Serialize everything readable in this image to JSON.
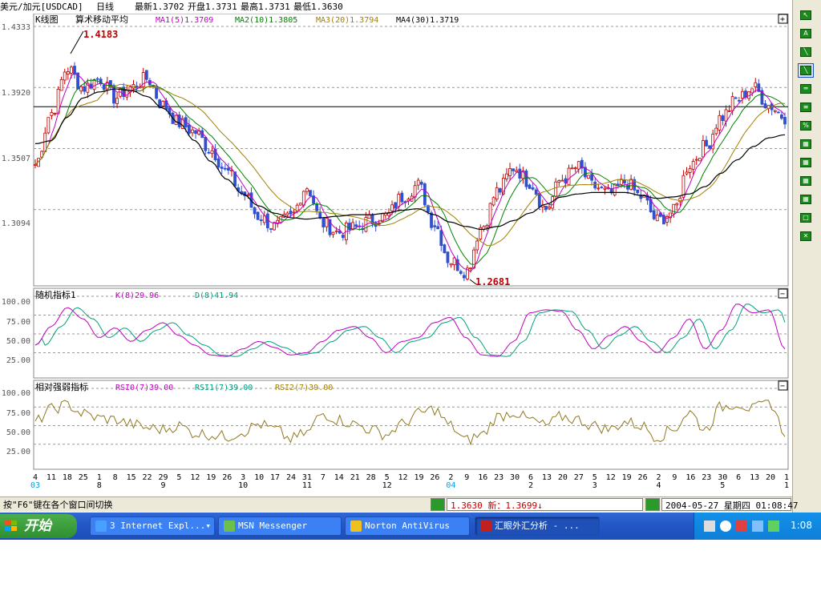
{
  "header": {
    "symbol": "美元/加元[USDCAD]",
    "period": "日线",
    "latest": "最新1.3702",
    "open": "开盘1.3731",
    "high": "最高1.3731",
    "low": "最低1.3630"
  },
  "main_chart": {
    "title": "K线图",
    "indicator_name": "算术移动平均",
    "ma_labels": [
      {
        "text": "MA1(5)1.3709",
        "color": "#c000c0"
      },
      {
        "text": "MA2(10)1.3805",
        "color": "#008000"
      },
      {
        "text": "MA3(20)1.3794",
        "color": "#a08000"
      },
      {
        "text": "MA4(30)1.3719",
        "color": "#000000"
      }
    ],
    "y_ticks": [
      "1.4333",
      "1.3920",
      "1.3507",
      "1.3094"
    ],
    "y_tick_values": [
      1.4333,
      1.392,
      1.3507,
      1.3094
    ],
    "high_marker": "1.4183",
    "low_marker": "1.2681",
    "ref_line_value": 1.379,
    "collapse_glyph": "+"
  },
  "kdj_panel": {
    "title": "随机指标1",
    "k_label": "K(8)29.96",
    "d_label": "D(8)41.94",
    "y_ticks": [
      "100.00",
      "75.00",
      "50.00",
      "25.00"
    ],
    "collapse_glyph": "−"
  },
  "rsi_panel": {
    "title": "相对强弱指标",
    "rsi0_label": "RSI0(7)39.00",
    "rsi1_label": "RSI1(7)39.00",
    "rsi2_label": "RSI2(7)39.00",
    "y_ticks": [
      "100.00",
      "75.00",
      "50.00",
      "25.00"
    ],
    "collapse_glyph": "−"
  },
  "x_axis": {
    "day_labels": [
      "4",
      "11",
      "18",
      "25",
      "1",
      "8",
      "15",
      "22",
      "29",
      "5",
      "12",
      "19",
      "26",
      "3",
      "10",
      "17",
      "24",
      "31",
      "7",
      "14",
      "21",
      "28",
      "5",
      "12",
      "19",
      "26",
      "2",
      "9",
      "16",
      "23",
      "30",
      "6",
      "13",
      "20",
      "27",
      "5",
      "12",
      "19",
      "26",
      "2",
      "9",
      "16",
      "23",
      "30",
      "6",
      "13",
      "20",
      "1"
    ],
    "month_labels": [
      {
        "text": "03",
        "color": "#00a0e0",
        "index": 0
      },
      {
        "text": "8",
        "color": "#000000",
        "index": 4
      },
      {
        "text": "9",
        "color": "#000000",
        "index": 8
      },
      {
        "text": "10",
        "color": "#000000",
        "index": 13
      },
      {
        "text": "11",
        "color": "#000000",
        "index": 17
      },
      {
        "text": "12",
        "color": "#000000",
        "index": 22
      },
      {
        "text": "04",
        "color": "#00a0e0",
        "index": 26
      },
      {
        "text": "2",
        "color": "#000000",
        "index": 31
      },
      {
        "text": "3",
        "color": "#000000",
        "index": 35
      },
      {
        "text": "4",
        "color": "#000000",
        "index": 39
      },
      {
        "text": "5",
        "color": "#000000",
        "index": 43
      },
      {
        "text": "1",
        "color": "#000000",
        "index": 47
      }
    ]
  },
  "chart_data": {
    "type": "line",
    "title": "",
    "ylim": [
      1.26,
      1.4333
    ],
    "close_anchors": [
      1.34,
      1.375,
      1.405,
      1.392,
      1.398,
      1.385,
      1.392,
      1.398,
      1.38,
      1.368,
      1.362,
      1.35,
      1.335,
      1.32,
      1.305,
      1.298,
      1.304,
      1.325,
      1.3,
      1.294,
      1.297,
      1.302,
      1.305,
      1.318,
      1.326,
      1.3,
      1.275,
      1.268,
      1.298,
      1.322,
      1.338,
      1.328,
      1.31,
      1.33,
      1.338,
      1.325,
      1.32,
      1.328,
      1.318,
      1.302,
      1.308,
      1.34,
      1.352,
      1.372,
      1.384,
      1.392,
      1.38,
      1.372
    ],
    "ma30_anchors": [
      1.354,
      1.356,
      1.372,
      1.385,
      1.389,
      1.391,
      1.39,
      1.386,
      1.378,
      1.368,
      1.356,
      1.342,
      1.33,
      1.32,
      1.312,
      1.307,
      1.304,
      1.303,
      1.304,
      1.305,
      1.306,
      1.306,
      1.307,
      1.309,
      1.31,
      1.306,
      1.301,
      1.298,
      1.296,
      1.298,
      1.302,
      1.307,
      1.313,
      1.318,
      1.32,
      1.321,
      1.321,
      1.321,
      1.319,
      1.317,
      1.318,
      1.32,
      1.325,
      1.334,
      1.343,
      1.352,
      1.358,
      1.36
    ],
    "kd_k_anchors": [
      35,
      60,
      85,
      70,
      45,
      58,
      40,
      55,
      65,
      48,
      35,
      22,
      20,
      30,
      40,
      32,
      22,
      25,
      40,
      55,
      60,
      45,
      25,
      40,
      45,
      65,
      72,
      45,
      22,
      20,
      40,
      78,
      82,
      80,
      55,
      30,
      48,
      60,
      40,
      25,
      45,
      70,
      30,
      55,
      90,
      78,
      82,
      30
    ],
    "rsi_anchors": [
      55,
      72,
      78,
      66,
      60,
      58,
      52,
      47,
      45,
      50,
      40,
      38,
      35,
      42,
      52,
      45,
      32,
      40,
      66,
      58,
      52,
      45,
      38,
      52,
      66,
      72,
      50,
      30,
      38,
      62,
      68,
      58,
      50,
      62,
      58,
      50,
      45,
      55,
      50,
      35,
      45,
      68,
      45,
      75,
      80,
      72,
      82,
      42
    ],
    "kd_d_label": "D(8)41.94",
    "k_label": "K(8)29.96"
  },
  "status_bar": {
    "hint": "按\"F6\"键在各个窗口间切换",
    "quote": "1.3630  新：1.3699",
    "datetime": "2004-05-27  星期四  01:08:47"
  },
  "taskbar": {
    "start_label": "开始",
    "tasks": [
      {
        "label": "3 Internet Expl...",
        "icon": "ie-icon"
      },
      {
        "label": "MSN Messenger",
        "icon": "msn-icon"
      },
      {
        "label": "Norton AntiVirus",
        "icon": "norton-icon"
      },
      {
        "label": "汇眼外汇分析 - ...",
        "icon": "forex-app-icon"
      }
    ],
    "clock": "1:08"
  },
  "toolbar": {
    "tools": [
      "cursor",
      "text",
      "line",
      "trend-line",
      "parallel-line",
      "channel",
      "fibonacci",
      "grid-1",
      "grid-2",
      "grid-3",
      "grid-4",
      "grid-5",
      "delete"
    ]
  },
  "colors": {
    "up_candle": "#c00000",
    "down_candle": "#3050d0",
    "ma1": "#c000c0",
    "ma2": "#008000",
    "ma3": "#a08000",
    "ma4": "#000000",
    "k_line": "#c000c0",
    "d_line": "#00a080",
    "rsi_line": "#907820",
    "marker_text": "#c00000"
  }
}
